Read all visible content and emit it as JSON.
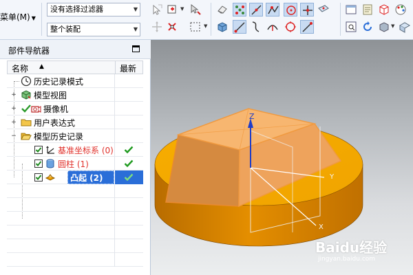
{
  "toolbar": {
    "menu_label": "菜单(M)",
    "filter_value": "没有选择过滤器",
    "scope_value": "整个装配"
  },
  "navigator": {
    "title": "部件导航器",
    "columns": {
      "name": "名称",
      "latest": "最新"
    },
    "items": [
      {
        "label": "历史记录模式",
        "icon": "clock-icon",
        "color": "#000000"
      },
      {
        "label": "模型视图",
        "icon": "model-views-icon",
        "color": "#000000"
      },
      {
        "label": "摄像机",
        "icon": "camera-icon",
        "color": "#000000"
      },
      {
        "label": "用户表达式",
        "icon": "folder-icon",
        "color": "#000000"
      },
      {
        "label": "模型历史记录",
        "icon": "open-folder-icon",
        "color": "#000000"
      },
      {
        "label": "基准坐标系 (0)",
        "icon": "datum-csys-icon",
        "color": "#e0302a",
        "checked": true,
        "latest": true
      },
      {
        "label": "圆柱 (1)",
        "icon": "cylinder-icon",
        "color": "#e0302a",
        "checked": true,
        "latest": true
      },
      {
        "label": "凸起 (2)",
        "icon": "emboss-icon",
        "color": "#ffffff",
        "checked": true,
        "latest": true,
        "selected": true
      }
    ]
  },
  "viewport": {
    "axis_labels": {
      "z": "Z",
      "y": "Y",
      "x": "X"
    },
    "colors": {
      "cylinder": "#f0a000",
      "emboss": "#f5b060",
      "background_top": "#8e9296",
      "background_bottom": "#eceeef",
      "selection": "#2a6ed8"
    }
  },
  "watermark": {
    "brand": "Baidu经验",
    "url": "jingyan.baidu.com"
  }
}
